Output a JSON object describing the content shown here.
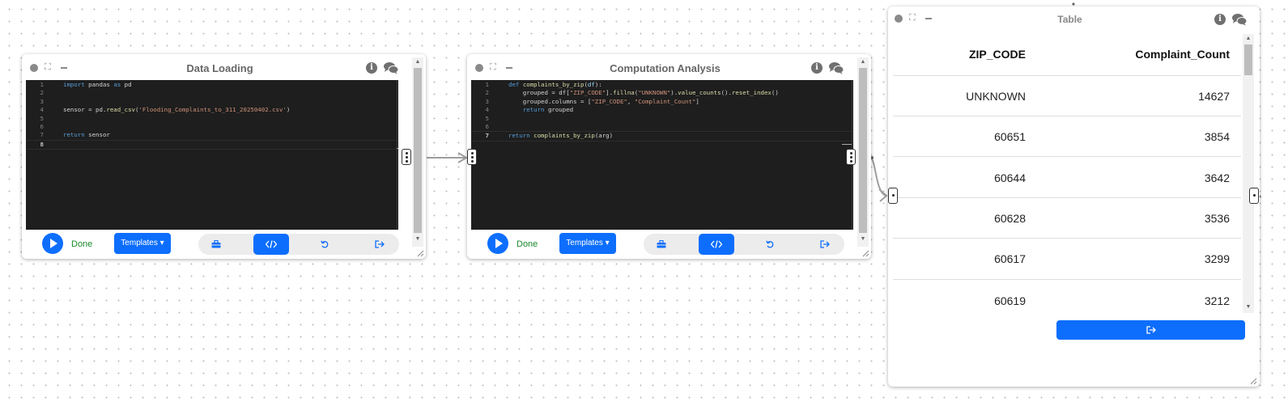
{
  "nodes": {
    "data_loading": {
      "title": "Data Loading",
      "status": "Done",
      "templates_label": "Templates",
      "code_lines": [
        {
          "num": "1",
          "text": "import pandas as pd"
        },
        {
          "num": "2",
          "text": ""
        },
        {
          "num": "3",
          "text": ""
        },
        {
          "num": "4",
          "text": "sensor = pd.read_csv('Flooding_Complaints_to_311_20250402.csv')"
        },
        {
          "num": "5",
          "text": ""
        },
        {
          "num": "6",
          "text": ""
        },
        {
          "num": "7",
          "text": "return sensor"
        },
        {
          "num": "8",
          "text": ""
        }
      ]
    },
    "computation_analysis": {
      "title": "Computation Analysis",
      "status": "Done",
      "templates_label": "Templates",
      "code_lines": [
        {
          "num": "1",
          "text": "def complaints_by_zip(df):"
        },
        {
          "num": "2",
          "text": "    grouped = df[\"ZIP_CODE\"].fillna(\"UNKNOWN\").value_counts().reset_index()"
        },
        {
          "num": "3",
          "text": "    grouped.columns = [\"ZIP_CODE\", \"Complaint_Count\"]"
        },
        {
          "num": "4",
          "text": "    return grouped"
        },
        {
          "num": "5",
          "text": ""
        },
        {
          "num": "6",
          "text": ""
        },
        {
          "num": "7",
          "text": "return complaints_by_zip(arg)"
        }
      ]
    },
    "table": {
      "title": "Table",
      "columns": [
        "ZIP_CODE",
        "Complaint_Count"
      ],
      "rows": [
        [
          "UNKNOWN",
          "14627"
        ],
        [
          "60651",
          "3854"
        ],
        [
          "60644",
          "3642"
        ],
        [
          "60628",
          "3536"
        ],
        [
          "60617",
          "3299"
        ],
        [
          "60619",
          "3212"
        ]
      ]
    }
  },
  "icons": {
    "info": "i",
    "chat": "chat-bubbles-icon",
    "toolbar": [
      "toolbox-icon",
      "code-icon",
      "undo-icon",
      "export-icon"
    ]
  },
  "colors": {
    "primary": "#0d6efd",
    "status_done": "#1a8a2a",
    "editor_bg": "#1e1e1e"
  }
}
